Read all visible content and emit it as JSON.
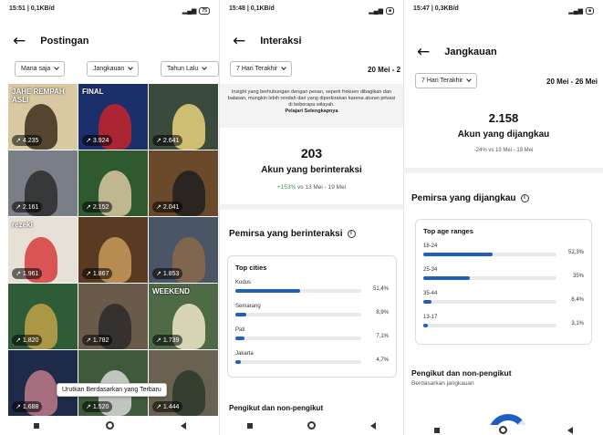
{
  "panel1": {
    "status_time": "15:51 | 0,1KB/d",
    "status_right": "75",
    "title": "Postingan",
    "filters": [
      "Mana saja",
      "Jangkauan",
      "Tahun Lalu"
    ],
    "thumbs": [
      {
        "caption": "JAHE REMPAH ASLI",
        "count": "4.235",
        "bg": "#d9c9a3",
        "accent": "#3b2f1d"
      },
      {
        "caption": "FINAL",
        "count": "3.924",
        "bg": "#1b2f6b",
        "accent": "#c4232b"
      },
      {
        "caption": "",
        "count": "2.641",
        "bg": "#3a4a3c",
        "accent": "#e8d27a"
      },
      {
        "caption": "",
        "count": "2.161",
        "bg": "#7a7e86",
        "accent": "#2c2c2c"
      },
      {
        "caption": "",
        "count": "2.152",
        "bg": "#2f5a30",
        "accent": "#d8c8a0"
      },
      {
        "caption": "",
        "count": "2.041",
        "bg": "#6b4a2b",
        "accent": "#1f1f1f"
      },
      {
        "caption": "rezeki",
        "count": "1.961",
        "bg": "#e7e0d6",
        "accent": "#d63b3b"
      },
      {
        "caption": "",
        "count": "1.867",
        "bg": "#5b3a22",
        "accent": "#c99a5b"
      },
      {
        "caption": "",
        "count": "1.853",
        "bg": "#4a5566",
        "accent": "#8a6a4a"
      },
      {
        "caption": "",
        "count": "1.820",
        "bg": "#2d5c36",
        "accent": "#c2a24a"
      },
      {
        "caption": "",
        "count": "1.782",
        "bg": "#6a5a4a",
        "accent": "#2a2a2a"
      },
      {
        "caption": "WEEKEND",
        "count": "1.739",
        "bg": "#4e6a46",
        "accent": "#f1e7c8"
      },
      {
        "caption": "",
        "count": "1.688",
        "bg": "#1e2b48",
        "accent": "#c07a8a"
      },
      {
        "caption": "",
        "count": "1.520",
        "bg": "#3e5a3a",
        "accent": "#d9d9d9"
      },
      {
        "caption": "",
        "count": "1.444",
        "bg": "#6a6250",
        "accent": "#2a3a2a"
      }
    ],
    "toast": "Urutkan Berdasarkan yang Terbaru"
  },
  "panel2": {
    "status_time": "15:48 | 0,1KB/d",
    "title": "Interaksi",
    "filter": "7 Hari Terakhir",
    "date_range": "20 Mei - 2",
    "info_text": "Insight yang berhubungan dengan pesan, seperti frekuen dibagikan dan balasan, mungkin lebih rendah dari yang diperkirakan karena aturan privasi di beberapa wilayah.",
    "info_link": "Pelajari Selengkapnya",
    "count": "203",
    "count_label": "Akun yang berinteraksi",
    "delta_pos": "+153%",
    "delta_rest": " vs 13 Mei - 19 Mei",
    "section_title": "Pemirsa yang berinteraksi",
    "card_title": "Top cities",
    "cities": [
      {
        "name": "Kudus",
        "pct": "51,4%",
        "value": 51.4
      },
      {
        "name": "Semarang",
        "pct": "8,9%",
        "value": 8.9
      },
      {
        "name": "Pati",
        "pct": "7,1%",
        "value": 7.1
      },
      {
        "name": "Jakarta",
        "pct": "4,7%",
        "value": 4.7
      }
    ],
    "section2_title": "Pengikut dan non-pengikut"
  },
  "panel3": {
    "status_time": "15:47 | 0,3KB/d",
    "title": "Jangkauan",
    "filter": "7 Hari Terakhir",
    "date_range": "20 Mei - 26 Mei",
    "count": "2.158",
    "count_label": "Akun yang dijangkau",
    "delta": "-24% vs 13 Mei - 19 Mei",
    "section_title": "Pemirsa yang dijangkau",
    "card_title": "Top age ranges",
    "ages": [
      {
        "name": "18-24",
        "pct": "52,3%",
        "value": 52.3
      },
      {
        "name": "25-34",
        "pct": "35%",
        "value": 35
      },
      {
        "name": "35-44",
        "pct": "6,4%",
        "value": 6.4
      },
      {
        "name": "13-17",
        "pct": "3,1%",
        "value": 3.1
      }
    ],
    "section2_title": "Pengikut dan non-pengikut",
    "section2_sub": "Berdasarkan jangkauan"
  }
}
